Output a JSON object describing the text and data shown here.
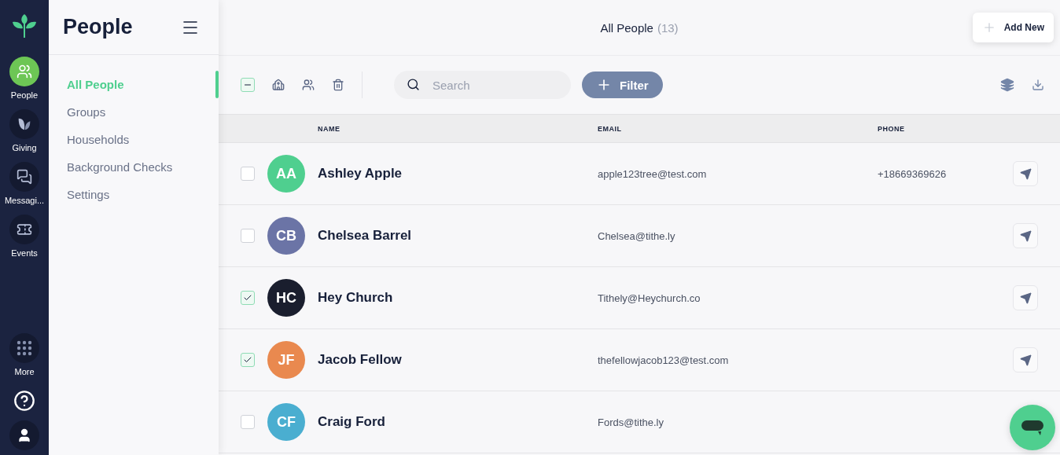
{
  "rail": {
    "items": [
      {
        "label": "People",
        "selected": true
      },
      {
        "label": "Giving",
        "selected": false
      },
      {
        "label": "Messagi...",
        "selected": false
      },
      {
        "label": "Events",
        "selected": false
      },
      {
        "label": "More",
        "selected": false
      }
    ]
  },
  "sidebar": {
    "title": "People",
    "items": [
      {
        "label": "All People",
        "selected": true
      },
      {
        "label": "Groups",
        "selected": false
      },
      {
        "label": "Households",
        "selected": false
      },
      {
        "label": "Background Checks",
        "selected": false
      },
      {
        "label": "Settings",
        "selected": false
      }
    ]
  },
  "header": {
    "title": "All People",
    "count": "(13)",
    "add_button": "Add New"
  },
  "toolbar": {
    "select_all": {
      "checked": true
    },
    "search": {
      "placeholder": "Search"
    },
    "filter_button": "Filter"
  },
  "table": {
    "columns": [
      "NAME",
      "EMAIL",
      "PHONE"
    ],
    "rows": [
      {
        "initials": "AA",
        "color": "#4fcf8f",
        "name": "Ashley Apple",
        "email": "apple123tree@test.com",
        "phone": "+18669369626",
        "checked": false
      },
      {
        "initials": "CB",
        "color": "#6b74a6",
        "name": "Chelsea Barrel",
        "email": "Chelsea@tithe.ly",
        "checked": false
      },
      {
        "initials": "HC",
        "color": "#1a1e2e",
        "name": "Hey Church",
        "email": "Tithely@Heychurch.co",
        "checked": true
      },
      {
        "initials": "JF",
        "color": "#e9894f",
        "name": "Jacob Fellow",
        "email": "thefellowjacob123@test.com",
        "checked": true
      },
      {
        "initials": "CF",
        "color": "#4aaed0",
        "name": "Craig Ford",
        "email": "Fords@tithe.ly",
        "checked": false
      }
    ]
  }
}
